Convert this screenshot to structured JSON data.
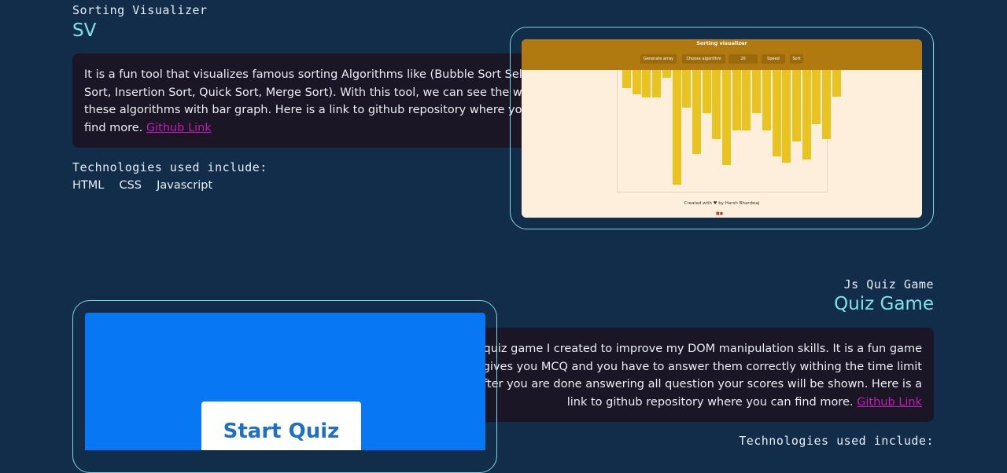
{
  "project1": {
    "subtitle": "Sorting Visualizer",
    "title": "SV",
    "description": "It is a fun tool that visualizes famous sorting Algorithms like (Bubble Sort Selection Sort, Insertion Sort, Quick Sort, Merge Sort). With this tool, we can see the working of these algorithms with bar graph. Here is a link to github repository where you can find more.",
    "link_label": "Github Link",
    "tech_heading": "Technologies used include:",
    "technologies": [
      "HTML",
      "CSS",
      "Javascript"
    ],
    "preview": {
      "app_title": "Sorting visualizer",
      "controls": [
        "Generate array",
        "Choose algorithm",
        "20",
        "Speed",
        "Sort"
      ],
      "bar_heights": [
        0.16,
        0.21,
        0.24,
        0.24,
        0.07,
        1.0,
        0.33,
        0.73,
        0.38,
        0.6,
        0.83,
        0.53,
        0.53,
        0.38,
        0.53,
        0.75,
        0.81,
        0.62,
        0.78,
        0.47,
        0.6,
        0.23
      ],
      "footer": "Created with ♥ by Harsh Bhardwaj",
      "bar_color": "#e9c420",
      "header_color": "#b07a10"
    }
  },
  "project2": {
    "subtitle": "Js Quiz Game",
    "title": "Quiz Game",
    "description": "A fun quiz game I created to improve my DOM manipulation skills. It is a fun game that gives you MCQ and you have to answer them correctly withing the time limit and after you are done answering all question your scores will be shown. Here is a link to github repository where you can find more.",
    "link_label": "Github Link",
    "tech_heading": "Technologies used include:",
    "preview": {
      "button_label": "Start Quiz",
      "background_color": "#0877f3"
    }
  },
  "colors": {
    "page_bg": "#112d4a",
    "accent": "#7fe3ea",
    "link": "#c21cb4",
    "card_bg": "#1a1625"
  }
}
